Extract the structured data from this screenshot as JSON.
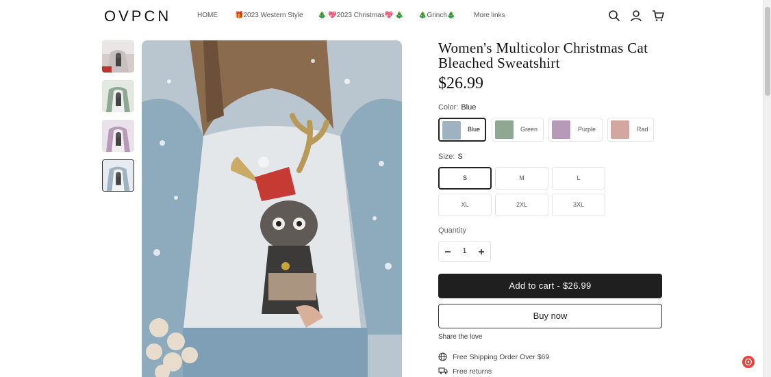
{
  "header": {
    "logo": "OVPCN",
    "nav": [
      {
        "label": "HOME"
      },
      {
        "label": "🎁2023 Western Style"
      },
      {
        "label": "🎄 💖2023 Christmas💖 🎄"
      },
      {
        "label": "🎄Grinch🎄"
      },
      {
        "label": "More links"
      }
    ],
    "icons": [
      "search-icon",
      "account-icon",
      "cart-icon"
    ]
  },
  "gallery": {
    "thumbnail_colors": [
      "#c9bfc0",
      "#8fa894",
      "#b79ab7",
      "#9fb2c2"
    ],
    "active_index": 3,
    "main_palette": {
      "sleeve": "#8eaabd",
      "body": "#e4e7ea",
      "jeans": "#7f9fb6"
    }
  },
  "product": {
    "title": "Women's Multicolor Christmas Cat Bleached Sweatshirt",
    "price": "$26.99",
    "color_label": "Color:",
    "color_selected": "Blue",
    "colors": [
      {
        "label": "Blue",
        "swatch": "#9fb2c2"
      },
      {
        "label": "Green",
        "swatch": "#8fa894"
      },
      {
        "label": "Purple",
        "swatch": "#b79ab7"
      },
      {
        "label": "Rad",
        "swatch": "#d3a7a0"
      }
    ],
    "size_label": "Size:",
    "size_selected": "S",
    "sizes": [
      "S",
      "M",
      "L",
      "XL",
      "2XL",
      "3XL"
    ],
    "quantity_label": "Quantity",
    "quantity": "1",
    "add_to_cart": "Add to cart - $26.99",
    "buy_now": "Buy now",
    "share": "Share the love",
    "perks": [
      {
        "icon": "globe-icon",
        "text": "Free Shipping Order Over $69"
      },
      {
        "icon": "truck-icon",
        "text": "Free returns"
      }
    ]
  },
  "chat_widget": {
    "icon": "chat-icon",
    "color": "#e8413c"
  }
}
